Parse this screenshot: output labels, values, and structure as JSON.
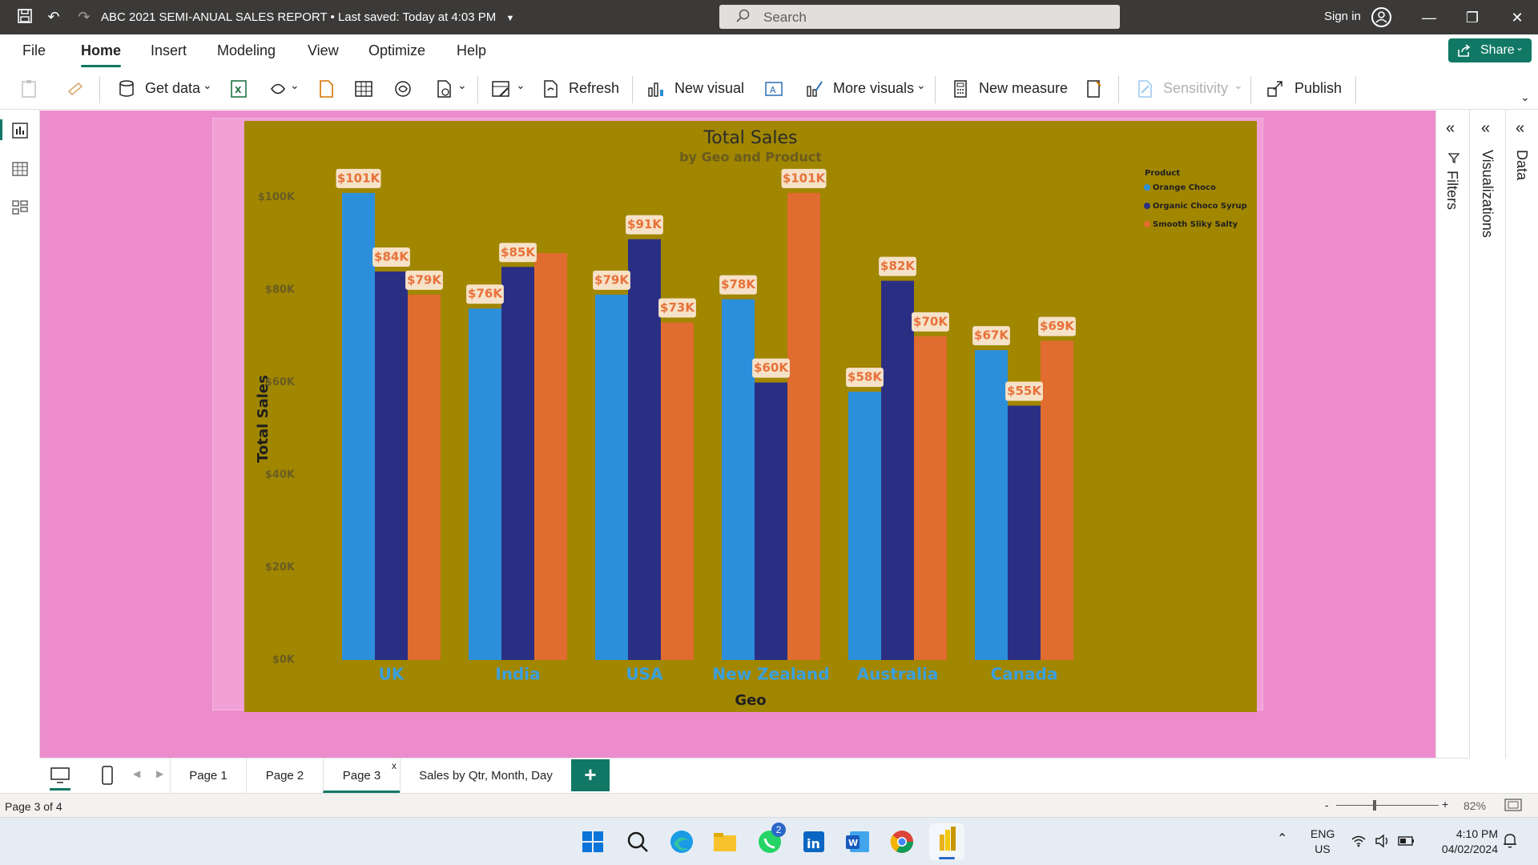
{
  "titlebar": {
    "document_title": "ABC 2021 SEMI-ANUAL SALES REPORT",
    "saved_status": "Last saved: Today at 4:03 PM",
    "search_placeholder": "Search",
    "sign_in": "Sign in"
  },
  "menu": {
    "items": [
      "File",
      "Home",
      "Insert",
      "Modeling",
      "View",
      "Optimize",
      "Help"
    ],
    "active": "Home",
    "share_label": "Share"
  },
  "ribbon": {
    "get_data": "Get data",
    "refresh": "Refresh",
    "new_visual": "New visual",
    "more_visuals": "More visuals",
    "new_measure": "New measure",
    "sensitivity": "Sensitivity",
    "publish": "Publish"
  },
  "panes": {
    "filters": "Filters",
    "visualizations": "Visualizations",
    "data": "Data"
  },
  "page_tabs": {
    "tabs": [
      "Page 1",
      "Page 2",
      "Page 3",
      "Sales by Qtr, Month, Day"
    ],
    "active": "Page 3",
    "close_glyph": "x",
    "add_glyph": "+"
  },
  "status": {
    "page_indicator": "Page 3 of 4",
    "zoom_minus": "-",
    "zoom_plus": "+",
    "zoom_level": "82%"
  },
  "taskbar": {
    "whatsapp_badge": "2",
    "lang": "ENG",
    "region": "US",
    "time": "4:10 PM",
    "date": "04/02/2024"
  },
  "colors": {
    "canvas_bg": "#ec8ccd",
    "chart_bg": "#a18600",
    "orange_choco": "#2b8fdb",
    "organic_choco_syrup": "#2b2f83",
    "smooth_sliky_salty": "#e06c2f",
    "accent": "#117865"
  },
  "chart_data": {
    "type": "bar",
    "title": "Total Sales",
    "subtitle": "by Geo and Product",
    "xlabel": "Geo",
    "ylabel": "Total Sales",
    "legend_title": "Product",
    "legend_position": "top-right",
    "ylim": [
      0,
      110000
    ],
    "y_ticks": [
      0,
      20000,
      40000,
      60000,
      80000,
      100000
    ],
    "y_tick_labels": [
      "$0K",
      "$20K",
      "$40K",
      "$60K",
      "$80K",
      "$100K"
    ],
    "grid": false,
    "categories": [
      "UK",
      "India",
      "USA",
      "New Zealand",
      "Australia",
      "Canada"
    ],
    "series": [
      {
        "name": "Orange Choco",
        "color": "#2b8fdb",
        "values": [
          101000,
          76000,
          79000,
          78000,
          58000,
          67000
        ],
        "labels": [
          "$101K",
          "$76K",
          "$79K",
          "$78K",
          "$58K",
          "$67K"
        ]
      },
      {
        "name": "Organic Choco Syrup",
        "color": "#2b2f83",
        "values": [
          84000,
          85000,
          91000,
          60000,
          82000,
          55000
        ],
        "labels": [
          "$84K",
          "$85K",
          "$91K",
          "$60K",
          "$82K",
          "$55K"
        ]
      },
      {
        "name": "Smooth Sliky Salty",
        "color": "#e06c2f",
        "values": [
          79000,
          88000,
          73000,
          101000,
          70000,
          69000
        ],
        "labels": [
          "$79K",
          "",
          "$73K",
          "$101K",
          "$70K",
          "$69K"
        ]
      }
    ]
  }
}
